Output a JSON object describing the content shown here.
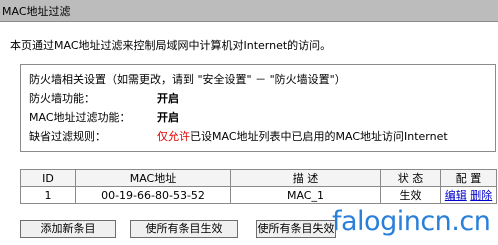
{
  "header": {
    "title": "MAC地址过滤"
  },
  "intro": "本页通过MAC地址过滤来控制局域网中计算机对Internet的访问。",
  "settings": {
    "heading": "防火墙相关设置（如需更改，请到 \"安全设置\" － \"防火墙设置\"）",
    "firewall_label": "防火墙功能：",
    "firewall_value": "开启",
    "mac_filter_label": "MAC地址过滤功能：",
    "mac_filter_value": "开启",
    "default_rule_label": "缺省过滤规则：",
    "default_rule_highlight": "仅允许",
    "default_rule_text": "已设MAC地址列表中已启用的MAC地址访问Internet"
  },
  "table": {
    "headers": [
      "ID",
      "MAC地址",
      "描 述",
      "状 态",
      "配 置"
    ],
    "rows": [
      {
        "id": "1",
        "mac": "00-19-66-80-53-52",
        "desc": "MAC_1",
        "status": "生效",
        "edit": "编辑",
        "delete": "删除"
      }
    ]
  },
  "buttons": {
    "add": "添加新条目",
    "enable_all": "使所有条目生效",
    "disable_all": "使所有条目失效"
  },
  "watermark": "falogincn.cn",
  "colors": {
    "header_bg": "#bcbcbc",
    "highlight": "#e00000",
    "link": "#0000cc",
    "watermark": "#2a7fd8"
  }
}
